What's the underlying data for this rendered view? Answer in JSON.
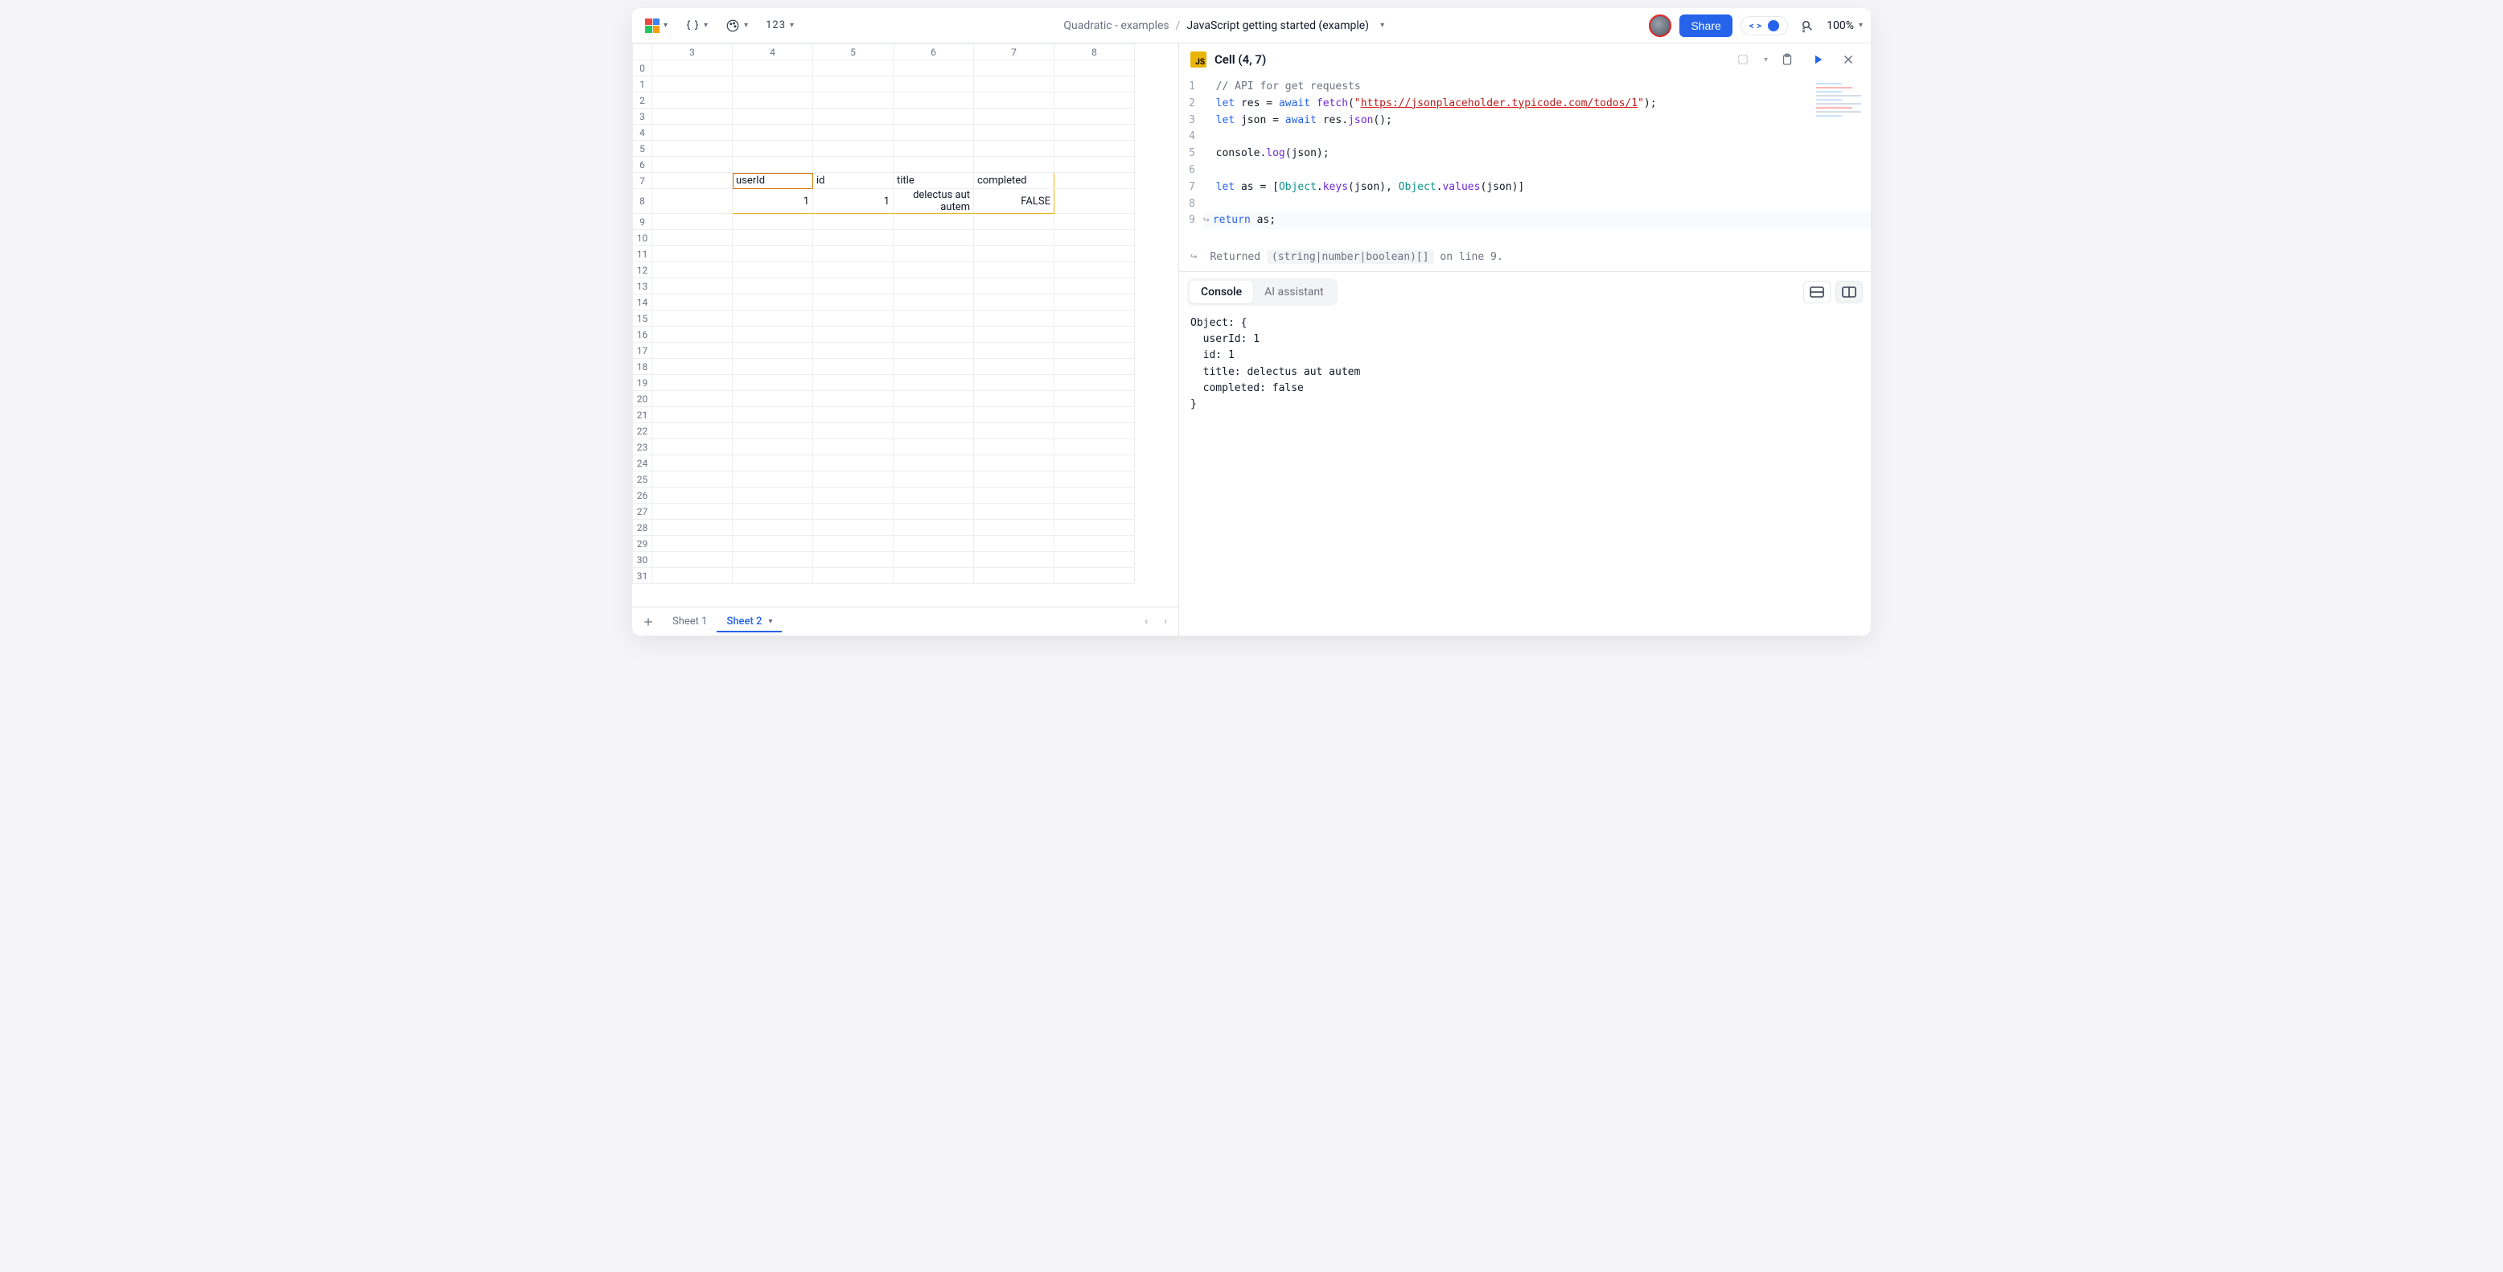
{
  "toolbar": {
    "number_format_label": "123"
  },
  "breadcrumb": {
    "workspace": "Quadratic - examples",
    "file": "JavaScript getting started (example)"
  },
  "actions": {
    "share_label": "Share",
    "code_symbol": "< >",
    "zoom": "100%"
  },
  "sheet": {
    "columns": [
      "3",
      "4",
      "5",
      "6",
      "7",
      "8"
    ],
    "row_start": 0,
    "row_end": 31,
    "selected_col_index": 1,
    "selected_row": 7,
    "data_rows": {
      "7": {
        "cells": [
          "",
          "userId",
          "id",
          "title",
          "completed",
          ""
        ],
        "align": [
          "",
          "l",
          "l",
          "l",
          "l",
          ""
        ]
      },
      "8": {
        "cells": [
          "",
          "1",
          "1",
          "delectus aut autem",
          "FALSE",
          ""
        ],
        "align": [
          "",
          "r",
          "r",
          "r",
          "r",
          ""
        ]
      }
    },
    "spill": {
      "r0": 7,
      "c0": 1,
      "r1": 8,
      "c1": 4
    },
    "tabs": [
      "Sheet 1",
      "Sheet 2"
    ],
    "active_tab": 1
  },
  "panel": {
    "badge": "JS",
    "title": "Cell (4, 7)",
    "lines": [
      {
        "n": 1,
        "html": "<span class='c-comment'>// API for get requests</span>"
      },
      {
        "n": 2,
        "html": "<span class='c-kw'>let</span> res = <span class='c-kw'>await</span> <span class='c-fn'>fetch</span>(<span class='c-str'>\"</span><span class='c-url'>https://jsonplaceholder.typicode.com/todos/1</span><span class='c-str'>\"</span>);"
      },
      {
        "n": 3,
        "html": "<span class='c-kw'>let</span> json = <span class='c-kw'>await</span> res.<span class='c-fn'>json</span>();"
      },
      {
        "n": 4,
        "html": ""
      },
      {
        "n": 5,
        "html": "console.<span class='c-fn'>log</span>(json);"
      },
      {
        "n": 6,
        "html": ""
      },
      {
        "n": 7,
        "html": "<span class='c-kw'>let</span> as = [<span class='c-obj'>Object</span>.<span class='c-fn'>keys</span>(json), <span class='c-obj'>Object</span>.<span class='c-fn'>values</span>(json)]"
      },
      {
        "n": 8,
        "html": ""
      },
      {
        "n": 9,
        "html": "<span class='c-kw'>return</span> as;",
        "cursor": true,
        "arrow": true
      }
    ],
    "status": {
      "prefix": "Returned",
      "type": "(string|number|boolean)[]",
      "suffix": "on line 9."
    },
    "bottom_tabs": [
      "Console",
      "AI assistant"
    ],
    "active_bottom_tab": 0,
    "console_output": "Object: {\n  userId: 1\n  id: 1\n  title: delectus aut autem\n  completed: false\n}"
  }
}
